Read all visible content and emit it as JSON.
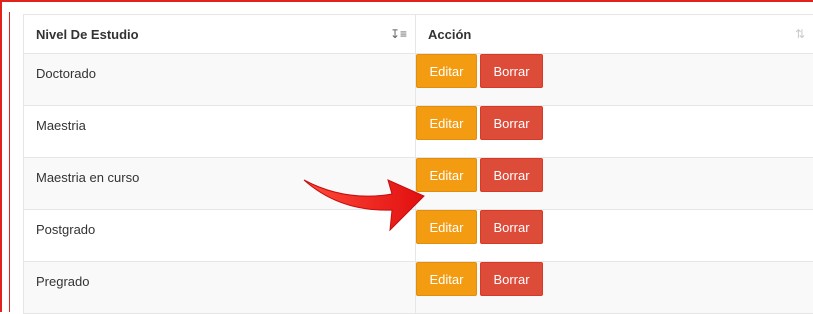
{
  "table": {
    "headers": {
      "level": "Nivel De Estudio",
      "action": "Acción"
    },
    "rows": [
      {
        "level": "Doctorado"
      },
      {
        "level": "Maestria"
      },
      {
        "level": "Maestria en curso"
      },
      {
        "level": "Postgrado"
      },
      {
        "level": "Pregrado"
      }
    ],
    "buttons": {
      "edit": "Editar",
      "delete": "Borrar"
    }
  },
  "colors": {
    "edit_button": "#f39c12",
    "delete_button": "#dd4b39",
    "frame_border": "#e0241b",
    "annotation_arrow": "#ff1a1a"
  },
  "icons": {
    "level_sort": "sort-amount-down-icon",
    "action_sort": "sort-icon"
  },
  "annotation": {
    "arrow_target": "Editar (Maestria en curso)"
  }
}
